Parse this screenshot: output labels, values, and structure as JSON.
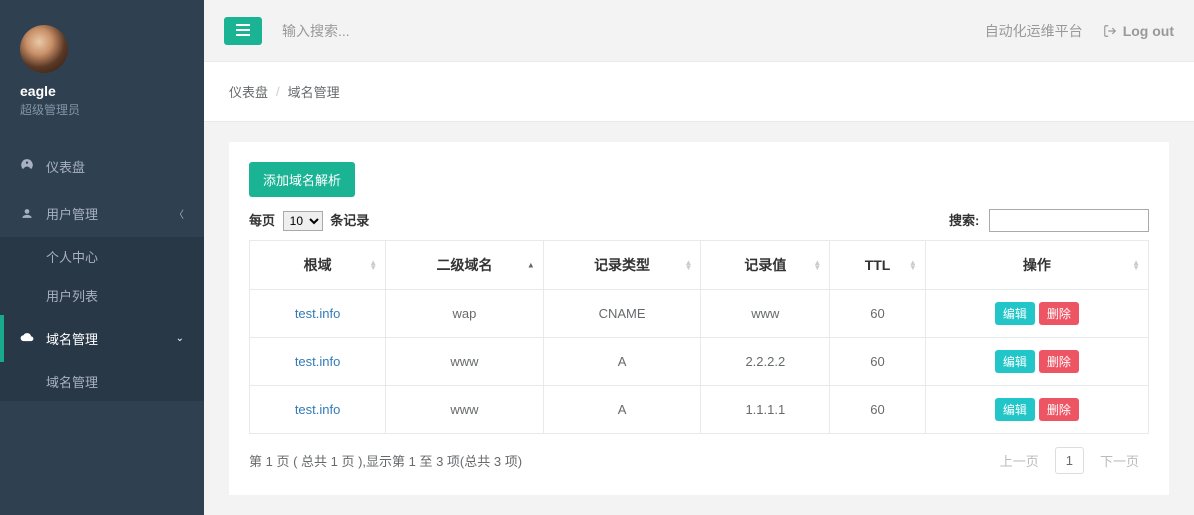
{
  "sidebar": {
    "username": "eagle",
    "userrole": "超级管理员",
    "items": [
      {
        "label": "仪表盘",
        "icon": "dashboard"
      },
      {
        "label": "用户管理",
        "icon": "users",
        "arrow": "left",
        "sub": [
          {
            "label": "个人中心"
          },
          {
            "label": "用户列表"
          }
        ]
      },
      {
        "label": "域名管理",
        "icon": "cloud",
        "active": true,
        "arrow": "down",
        "sub": [
          {
            "label": "域名管理"
          }
        ]
      }
    ]
  },
  "topnav": {
    "search_placeholder": "输入搜索...",
    "platform_label": "自动化运维平台",
    "logout_label": "Log out"
  },
  "breadcrumb": {
    "root": "仪表盘",
    "current": "域名管理"
  },
  "panel": {
    "add_button": "添加域名解析",
    "length_prefix": "每页",
    "length_value": "10",
    "length_suffix": "条记录",
    "search_label": "搜索:",
    "columns": [
      "根域",
      "二级域名",
      "记录类型",
      "记录值",
      "TTL",
      "操作"
    ],
    "edit_label": "编辑",
    "delete_label": "删除",
    "rows": [
      {
        "root": "test.info",
        "sub": "wap",
        "type": "CNAME",
        "value": "www",
        "ttl": "60"
      },
      {
        "root": "test.info",
        "sub": "www",
        "type": "A",
        "value": "2.2.2.2",
        "ttl": "60"
      },
      {
        "root": "test.info",
        "sub": "www",
        "type": "A",
        "value": "1.1.1.1",
        "ttl": "60"
      }
    ],
    "info_text": "第 1 页 ( 总共 1 页 ),显示第 1 至 3 项(总共 3 项)",
    "prev_label": "上一页",
    "page_number": "1",
    "next_label": "下一页"
  }
}
